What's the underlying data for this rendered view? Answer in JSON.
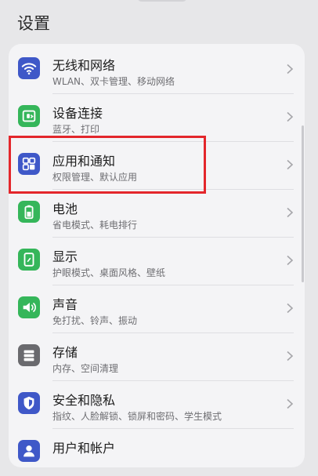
{
  "header": {
    "title": "设置"
  },
  "items": [
    {
      "title": "无线和网络",
      "subtitle": "WLAN、双卡管理、移动网络",
      "icon": "wifi-icon",
      "color": "#3f58c8"
    },
    {
      "title": "设备连接",
      "subtitle": "蓝牙、打印",
      "icon": "device-connection-icon",
      "color": "#35b65a"
    },
    {
      "title": "应用和通知",
      "subtitle": "权限管理、默认应用",
      "icon": "apps-grid-icon",
      "color": "#3f58c8"
    },
    {
      "title": "电池",
      "subtitle": "省电模式、耗电排行",
      "icon": "battery-icon",
      "color": "#35b65a"
    },
    {
      "title": "显示",
      "subtitle": "护眼模式、桌面风格、壁纸",
      "icon": "display-icon",
      "color": "#35b65a"
    },
    {
      "title": "声音",
      "subtitle": "免打扰、铃声、振动",
      "icon": "sound-icon",
      "color": "#35b65a"
    },
    {
      "title": "存储",
      "subtitle": "内存、空间清理",
      "icon": "storage-icon",
      "color": "#6a6a6e"
    },
    {
      "title": "安全和隐私",
      "subtitle": "指纹、人脸解锁、锁屏和密码、学生模式",
      "icon": "security-shield-icon",
      "color": "#3f58c8"
    },
    {
      "title": "用户和帐户",
      "subtitle": "",
      "icon": "user-account-icon",
      "color": "#3f58c8"
    }
  ],
  "colors": {
    "highlight": "#e3262b",
    "blue": "#3f58c8",
    "green": "#35b65a"
  }
}
